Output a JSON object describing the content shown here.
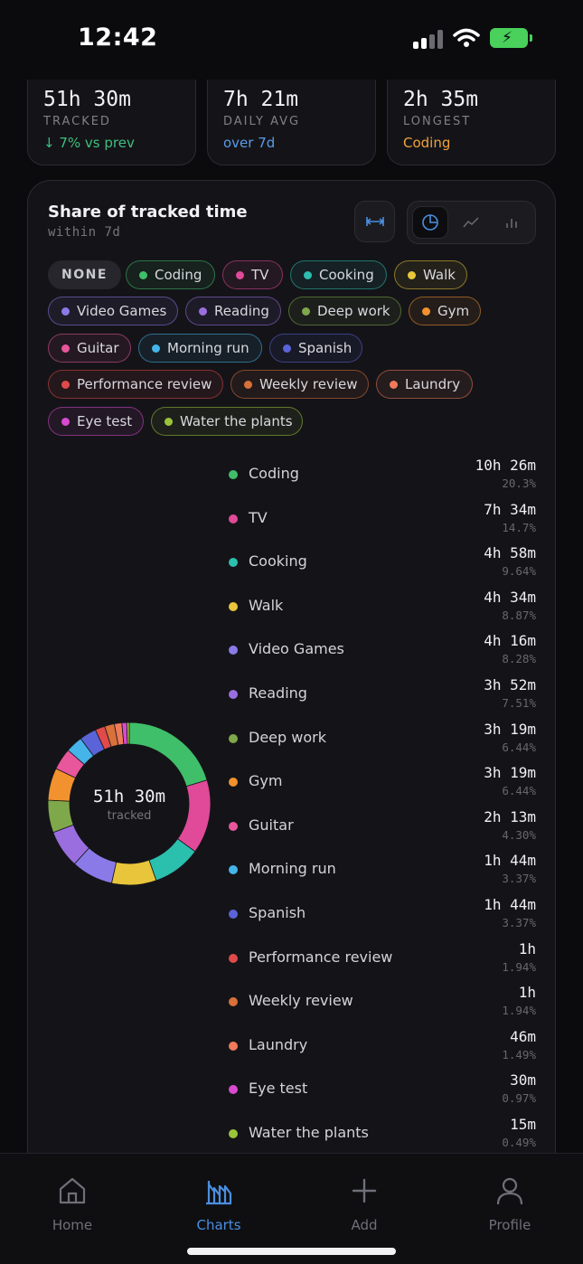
{
  "status_bar": {
    "time": "12:42"
  },
  "stats": {
    "tracked": {
      "value": "51h 30m",
      "label": "TRACKED",
      "sub": "↓ 7% vs prev",
      "sub_color": "#3fbf7f"
    },
    "daily_avg": {
      "value": "7h 21m",
      "label": "DAILY AVG",
      "sub": "over 7d",
      "sub_color": "#5b9be6"
    },
    "longest": {
      "value": "2h 35m",
      "label": "LONGEST",
      "sub": "Coding",
      "sub_color": "#f0a33c"
    }
  },
  "share_card": {
    "title": "Share of tracked time",
    "subtitle": "within 7d",
    "view_modes": [
      "pie",
      "line",
      "bar"
    ],
    "active_view": "pie"
  },
  "chips": {
    "none_label": "NONE",
    "items": [
      {
        "label": "Coding",
        "color": "#3fbf6a"
      },
      {
        "label": "TV",
        "color": "#e04a98"
      },
      {
        "label": "Cooking",
        "color": "#2bbfae"
      },
      {
        "label": "Walk",
        "color": "#e8c53a"
      },
      {
        "label": "Video Games",
        "color": "#8a7ae8"
      },
      {
        "label": "Reading",
        "color": "#9b6ee0"
      },
      {
        "label": "Deep work",
        "color": "#7fa84a"
      },
      {
        "label": "Gym",
        "color": "#f2922e"
      },
      {
        "label": "Guitar",
        "color": "#e8569c"
      },
      {
        "label": "Morning run",
        "color": "#45b4e8"
      },
      {
        "label": "Spanish",
        "color": "#5a63d8"
      },
      {
        "label": "Performance review",
        "color": "#e04a4a"
      },
      {
        "label": "Weekly review",
        "color": "#d8713a"
      },
      {
        "label": "Laundry",
        "color": "#f07a5a"
      },
      {
        "label": "Eye test",
        "color": "#d84ad0"
      },
      {
        "label": "Water the plants",
        "color": "#9cc43a"
      }
    ]
  },
  "donut_center": {
    "value": "51h 30m",
    "label": "tracked"
  },
  "chart_data": {
    "type": "pie",
    "total": "51h 30m",
    "series": [
      {
        "name": "Coding",
        "duration": "10h 26m",
        "percent": 20.3,
        "color": "#3fbf6a"
      },
      {
        "name": "TV",
        "duration": "7h 34m",
        "percent": 14.7,
        "color": "#e04a98"
      },
      {
        "name": "Cooking",
        "duration": "4h 58m",
        "percent": 9.64,
        "color": "#2bbfae"
      },
      {
        "name": "Walk",
        "duration": "4h 34m",
        "percent": 8.87,
        "color": "#e8c53a"
      },
      {
        "name": "Video Games",
        "duration": "4h 16m",
        "percent": 8.28,
        "color": "#8a7ae8"
      },
      {
        "name": "Reading",
        "duration": "3h 52m",
        "percent": 7.51,
        "color": "#9b6ee0"
      },
      {
        "name": "Deep work",
        "duration": "3h 19m",
        "percent": 6.44,
        "color": "#7fa84a"
      },
      {
        "name": "Gym",
        "duration": "3h 19m",
        "percent": 6.44,
        "color": "#f2922e"
      },
      {
        "name": "Guitar",
        "duration": "2h 13m",
        "percent": 4.3,
        "color": "#e8569c"
      },
      {
        "name": "Morning run",
        "duration": "1h 44m",
        "percent": 3.37,
        "color": "#45b4e8"
      },
      {
        "name": "Spanish",
        "duration": "1h 44m",
        "percent": 3.37,
        "color": "#5a63d8"
      },
      {
        "name": "Performance review",
        "duration": "1h",
        "percent": 1.94,
        "color": "#e04a4a"
      },
      {
        "name": "Weekly review",
        "duration": "1h",
        "percent": 1.94,
        "color": "#d8713a"
      },
      {
        "name": "Laundry",
        "duration": "46m",
        "percent": 1.49,
        "color": "#f07a5a"
      },
      {
        "name": "Eye test",
        "duration": "30m",
        "percent": 0.97,
        "color": "#d84ad0"
      },
      {
        "name": "Water the plants",
        "duration": "15m",
        "percent": 0.49,
        "color": "#9cc43a"
      }
    ]
  },
  "legend_pct_text": [
    "20.3%",
    "14.7%",
    "9.64%",
    "8.87%",
    "8.28%",
    "7.51%",
    "6.44%",
    "6.44%",
    "4.30%",
    "3.37%",
    "3.37%",
    "1.94%",
    "1.94%",
    "1.49%",
    "0.97%",
    "0.49%"
  ],
  "tab_bar": {
    "items": [
      {
        "label": "Home",
        "icon": "home-icon"
      },
      {
        "label": "Charts",
        "icon": "bar-chart-icon"
      },
      {
        "label": "Add",
        "icon": "plus-icon"
      },
      {
        "label": "Profile",
        "icon": "person-icon"
      }
    ],
    "active": "Charts",
    "active_color": "#4a8fe0"
  }
}
